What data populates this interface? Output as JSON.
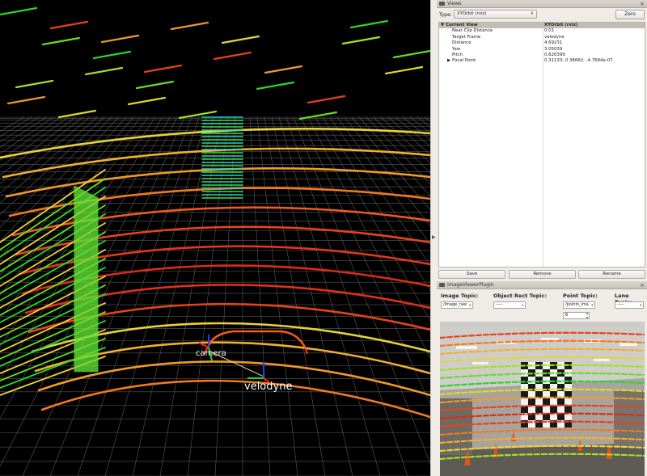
{
  "viewport": {
    "frame_labels": {
      "camera": "camera",
      "velodyne": "velodyne"
    }
  },
  "views_panel": {
    "title": "Views",
    "type_label": "Type:",
    "type_value": "XYOrbit (rviz)",
    "zero_label": "Zero",
    "tree": {
      "header": {
        "name": "Current View",
        "value": "XYOrbit (rviz)"
      },
      "rows": [
        {
          "name": "Near Clip Distance",
          "value": "0.01"
        },
        {
          "name": "Target Frame",
          "value": "velodyne"
        },
        {
          "name": "Distance",
          "value": "4.69231"
        },
        {
          "name": "Yaw",
          "value": "3.05039"
        },
        {
          "name": "Pitch",
          "value": "0.620399"
        },
        {
          "name": "Focal Point",
          "value": "0.31133; 0.38662; -4.7684e-07"
        }
      ]
    },
    "buttons": {
      "save": "Save",
      "remove": "Remove",
      "rename": "Rename"
    }
  },
  "image_viewer": {
    "title": "ImageViewerPlugin",
    "image_topic_label": "Image Topic:",
    "image_topic_value": "/image_raw",
    "rect_topic_label": "Object Rect Topic:",
    "rect_topic_value": "-----",
    "point_topic_label": "Point Topic:",
    "point_topic_value": "/points_ima",
    "point_size_value": "6",
    "lane_topic_label": "Lane Topic:",
    "lane_topic_value": "-----"
  },
  "colors": {
    "viewport_bg": "#000000",
    "grid": "#5a5a5a",
    "panel_bg": "#efebe7",
    "tree_header": "#c5bdb3"
  }
}
